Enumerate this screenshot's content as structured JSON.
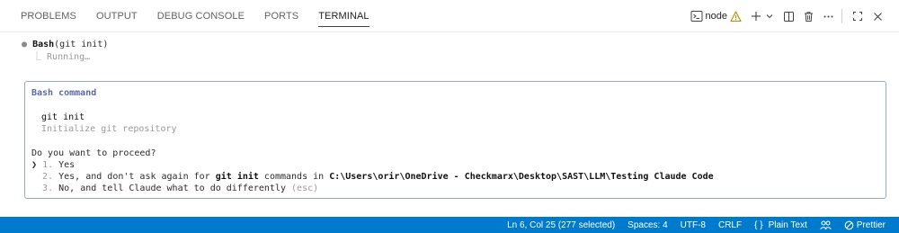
{
  "panel": {
    "tabs": [
      {
        "label": "PROBLEMS"
      },
      {
        "label": "OUTPUT"
      },
      {
        "label": "DEBUG CONSOLE"
      },
      {
        "label": "PORTS"
      },
      {
        "label": "TERMINAL",
        "active": true
      }
    ],
    "terminal_name": "node"
  },
  "terminal": {
    "tool_call": {
      "bullet": "●",
      "tool": "Bash",
      "args": "(git init)"
    },
    "status": {
      "prefix": "⎿",
      "text": "Running…"
    },
    "prompt": {
      "title": "Bash command",
      "command": "git init",
      "description": "Initialize git repository",
      "question": "Do you want to proceed?",
      "cursor": "❯",
      "options": [
        {
          "number": "1.",
          "text": "Yes"
        },
        {
          "number": "2.",
          "text_before": "Yes, and don't ask again for ",
          "command": "git init",
          "text_middle": " commands in ",
          "path": "C:\\Users\\orir\\OneDrive - Checkmarx\\Desktop\\SAST\\LLM\\Testing Claude Code"
        },
        {
          "number": "3.",
          "text": "No, and tell Claude what to do differently",
          "hint": "(esc)"
        }
      ]
    }
  },
  "statusbar": {
    "position": "Ln 6, Col 25 (277 selected)",
    "spaces": "Spaces: 4",
    "encoding": "UTF-8",
    "eol": "CRLF",
    "language": "Plain Text",
    "formatter": "Prettier",
    "language_icon": "{ }"
  },
  "colors": {
    "accent": "#007acc",
    "box_border": "#9aa6c8",
    "warning": "#b58900"
  }
}
